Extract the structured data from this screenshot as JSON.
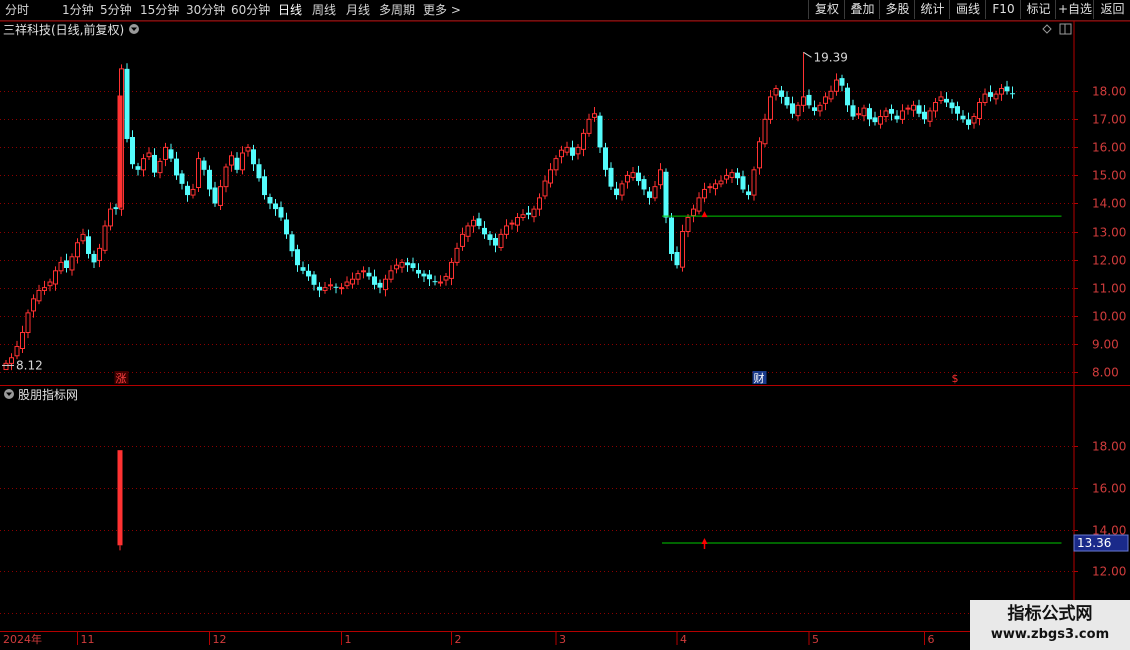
{
  "toolbar": {
    "periods": [
      "分时",
      "1分钟",
      "5分钟",
      "15分钟",
      "30分钟",
      "60分钟",
      "日线",
      "周线",
      "月线",
      "多周期",
      "更多 >"
    ],
    "active_period": "日线",
    "buttons": [
      "复权",
      "叠加",
      "多股",
      "统计",
      "画线",
      "F10",
      "标记",
      "+自选",
      "返回"
    ]
  },
  "main_panel": {
    "title": "三祥科技(日线,前复权)",
    "high_label": "19.39",
    "low_label": "8.12",
    "markers": [
      "涨",
      "财",
      "$"
    ]
  },
  "sub_panel": {
    "title": "股朋指标网",
    "price_box": "13.36"
  },
  "colors": {
    "up": "#ff3232",
    "down": "#54fcfc",
    "line": "#00c800",
    "grid": "#8b0000",
    "axis": "#b40000",
    "signal": "#ff0000"
  },
  "chart_data": [
    {
      "type": "candlestick",
      "title": "三祥科技(日线,前复权)",
      "y_ticks": [
        8.0,
        9.0,
        10.0,
        11.0,
        12.0,
        13.0,
        14.0,
        15.0,
        16.0,
        17.0,
        18.0
      ],
      "ylim": [
        7.6,
        19.9
      ],
      "x_labels": [
        "2024年",
        "11",
        "12",
        "1",
        "2",
        "3",
        "4",
        "5",
        "6"
      ],
      "close_series": [
        8.3,
        8.5,
        8.9,
        9.4,
        10.1,
        10.6,
        10.9,
        11.0,
        11.2,
        11.6,
        11.9,
        11.7,
        12.1,
        12.6,
        12.9,
        12.2,
        11.9,
        12.4,
        13.2,
        13.8,
        13.8,
        18.8,
        16.3,
        15.4,
        15.2,
        15.6,
        15.8,
        15.1,
        15.5,
        16.0,
        15.6,
        15.0,
        14.7,
        14.3,
        14.5,
        15.6,
        15.2,
        14.5,
        14.0,
        14.6,
        15.3,
        15.7,
        15.2,
        15.8,
        16.0,
        15.4,
        14.9,
        14.3,
        14.0,
        13.8,
        13.5,
        12.9,
        12.3,
        11.8,
        11.6,
        11.4,
        11.1,
        10.9,
        11.0,
        11.1,
        11.0,
        11.0,
        11.2,
        11.3,
        11.5,
        11.6,
        11.4,
        11.1,
        11.0,
        11.3,
        11.6,
        11.8,
        11.9,
        11.8,
        11.7,
        11.5,
        11.4,
        11.3,
        11.2,
        11.2,
        11.4,
        11.9,
        12.4,
        12.9,
        13.2,
        13.4,
        13.2,
        12.9,
        12.7,
        12.5,
        12.9,
        13.2,
        13.3,
        13.5,
        13.6,
        13.6,
        13.8,
        14.2,
        14.8,
        15.2,
        15.6,
        15.9,
        16.0,
        15.7,
        16.0,
        16.5,
        17.0,
        17.2,
        16.0,
        15.2,
        14.6,
        14.3,
        14.7,
        15.0,
        15.1,
        14.8,
        14.5,
        14.2,
        14.6,
        15.2,
        13.5,
        12.2,
        11.8,
        13.0,
        13.5,
        13.8,
        14.2,
        14.5,
        14.6,
        14.7,
        14.8,
        15.0,
        15.1,
        14.9,
        14.5,
        14.3,
        15.2,
        16.2,
        17.0,
        17.8,
        18.1,
        17.8,
        17.5,
        17.2,
        17.5,
        17.8,
        17.5,
        17.3,
        17.5,
        17.8,
        18.0,
        18.4,
        18.2,
        17.5,
        17.1,
        17.2,
        17.4,
        17.0,
        16.9,
        17.1,
        17.3,
        17.2,
        17.0,
        17.3,
        17.4,
        17.5,
        17.2,
        17.0,
        17.3,
        17.6,
        17.8,
        17.6,
        17.4,
        17.2,
        17.0,
        16.8,
        17.1,
        17.6,
        17.9,
        17.8,
        17.9,
        18.1,
        18.0,
        17.9
      ],
      "markers": [
        {
          "label": "涨",
          "x_index": 21
        },
        {
          "label": "财",
          "x_index": 137
        },
        {
          "label": "$",
          "x_index": 173
        }
      ],
      "high_annotation": {
        "value": 19.39,
        "x_index": 145
      },
      "low_annotation": {
        "value": 8.12,
        "x_index": 0
      },
      "horizontal_line": {
        "value": 13.55,
        "from_index": 120,
        "to_index": 191
      }
    },
    {
      "type": "indicator",
      "title": "股朋指标网",
      "y_ticks": [
        10.0,
        12.0,
        14.0,
        16.0,
        18.0
      ],
      "ylim": [
        9.2,
        20.2
      ],
      "bar": {
        "x_index": 21,
        "from": 13.25,
        "to": 17.8
      },
      "horizontal_line": {
        "value": 13.36,
        "from_index": 120,
        "to_index": 191
      },
      "arrow": {
        "x_index": 127,
        "value": 13.36
      }
    }
  ],
  "watermark": {
    "title": "指标公式网",
    "url": "www.zbgs3.com"
  }
}
